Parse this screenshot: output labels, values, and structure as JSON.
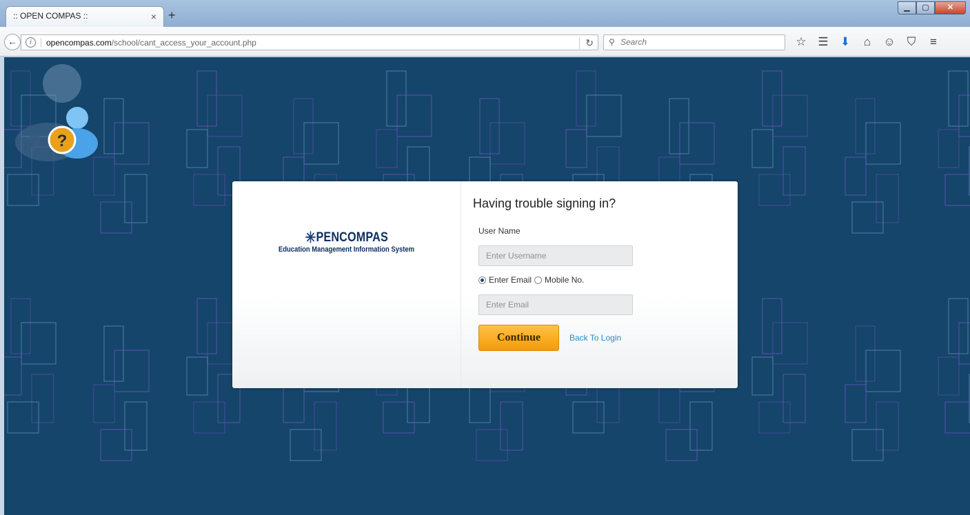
{
  "browser": {
    "tab_title": ":: OPEN COMPAS ::",
    "tab_close": "×",
    "new_tab": "+",
    "url_host": "opencompas.com",
    "url_path": "/school/cant_access_your_account.php",
    "search_placeholder": "Search",
    "window_controls": [
      "minimize",
      "maximize",
      "close"
    ],
    "toolbar_icons": [
      "bookmark-star-icon",
      "reading-list-icon",
      "download-icon",
      "home-icon",
      "chat-icon",
      "pocket-icon",
      "menu-icon"
    ]
  },
  "logo": {
    "brand_text": "PENCOMPAS",
    "tagline": "Education Management Information System"
  },
  "form": {
    "heading": "Having trouble signing in?",
    "username_label": "User Name",
    "username_placeholder": "Enter Username",
    "option_email": "Enter Email",
    "option_mobile": "Mobile No.",
    "selected_option": "Enter Email",
    "email_placeholder": "Enter Email",
    "continue_label": "Continue",
    "back_link": "Back To Login"
  },
  "colors": {
    "page_bg": "#15456a",
    "accent_button": "#f59b0a",
    "link": "#2a8bc3"
  }
}
